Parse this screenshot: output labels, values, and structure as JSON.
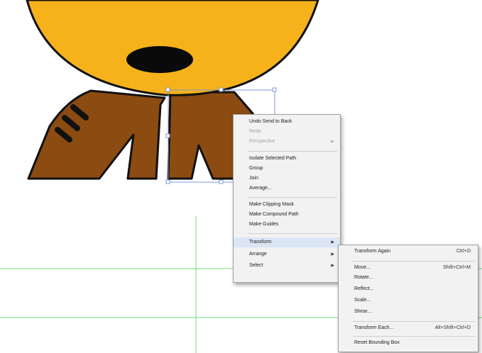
{
  "colors": {
    "head_fill": "#f6b21b",
    "outline": "#111111",
    "leg_fill": "#8b4b11",
    "nose_fill": "#0a0a0a",
    "guide_green": "#6fe07a",
    "selection_blue": "#7f99d6",
    "menu_bg": "#f2f2f2"
  },
  "context_menu": {
    "items": [
      {
        "label": "Undo Send to Back",
        "enabled": true
      },
      {
        "label": "Redo",
        "enabled": false
      },
      {
        "label": "Perspective",
        "enabled": false,
        "submenu": true
      },
      {
        "separator": true
      },
      {
        "label": "Isolate Selected Path",
        "enabled": true
      },
      {
        "label": "Group",
        "enabled": true
      },
      {
        "label": "Join",
        "enabled": true
      },
      {
        "label": "Average...",
        "enabled": true
      },
      {
        "separator": true
      },
      {
        "label": "Make Clipping Mask",
        "enabled": true
      },
      {
        "label": "Make Compound Path",
        "enabled": true
      },
      {
        "label": "Make Guides",
        "enabled": true
      },
      {
        "separator": true
      },
      {
        "label": "Transform",
        "enabled": true,
        "submenu": true
      },
      {
        "label": "Arrange",
        "enabled": true,
        "submenu": true
      },
      {
        "label": "Select",
        "enabled": true,
        "submenu": true
      }
    ]
  },
  "transform_submenu": {
    "items": [
      {
        "label": "Transform Again",
        "shortcut": "Ctrl+D"
      },
      {
        "separator": true
      },
      {
        "label": "Move...",
        "shortcut": "Shift+Ctrl+M"
      },
      {
        "label": "Rotate...",
        "shortcut": ""
      },
      {
        "label": "Reflect...",
        "shortcut": ""
      },
      {
        "label": "Scale...",
        "shortcut": ""
      },
      {
        "label": "Shear...",
        "shortcut": ""
      },
      {
        "separator": true
      },
      {
        "label": "Transform Each...",
        "shortcut": "Alt+Shift+Ctrl+D"
      },
      {
        "separator": true
      },
      {
        "label": "Reset Bounding Box",
        "shortcut": ""
      }
    ]
  }
}
